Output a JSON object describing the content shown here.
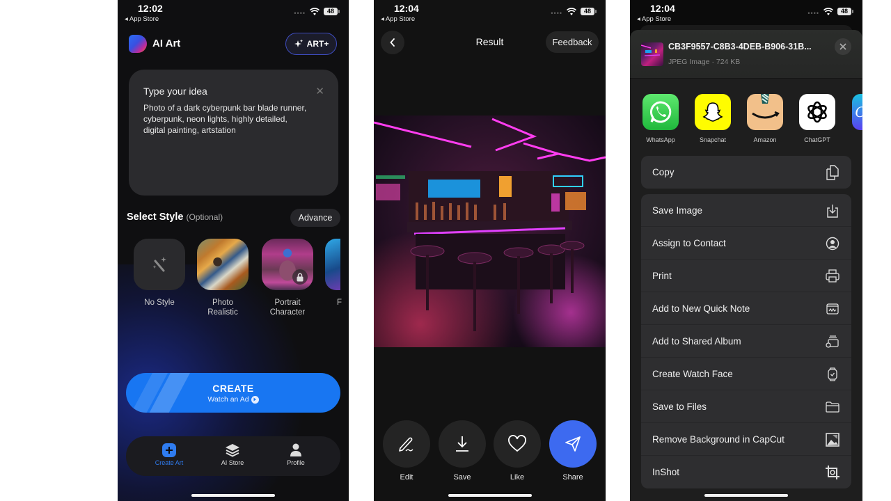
{
  "colors": {
    "accent_blue": "#1876f2",
    "share_blue": "#3d6af0",
    "tab_active": "#2f7cf0",
    "card_bg": "#2b2b2e"
  },
  "screens": [
    {
      "status": {
        "time": "12:02",
        "back_label": "◂ App Store",
        "battery": "48"
      },
      "header": {
        "app_title": "AI Art",
        "logo_icon": "ai-art-logo",
        "premium_button": "ART+",
        "premium_icon": "sparkles-icon"
      },
      "prompt": {
        "title": "Type your idea",
        "value": "Photo of a dark cyberpunk bar blade runner, cyberpunk, neon lights, highly detailed, digital painting, artstation",
        "clear_icon": "close-icon"
      },
      "style_section": {
        "title": "Select Style",
        "optional": "(Optional)",
        "advance_button": "Advance",
        "styles": [
          {
            "label": "No Style",
            "icon": "magic-wand-icon"
          },
          {
            "label": "Photo Realistic"
          },
          {
            "label": "Portrait Character",
            "locked": true
          },
          {
            "label": "F"
          }
        ]
      },
      "create_button": {
        "label": "CREATE",
        "sub_label": "Watch an Ad",
        "icon": "play-icon"
      },
      "tabbar": [
        {
          "label": "Create Art",
          "icon": "plus-square-icon",
          "active": true
        },
        {
          "label": "AI Store",
          "icon": "layers-icon",
          "active": false
        },
        {
          "label": "Profile",
          "icon": "person-icon",
          "active": false
        }
      ]
    },
    {
      "status": {
        "time": "12:04",
        "back_label": "◂ App Store",
        "battery": "48"
      },
      "header": {
        "back_icon": "chevron-left-icon",
        "title": "Result",
        "feedback_button": "Feedback"
      },
      "image": {
        "description": "Neon cyberpunk bar interior with stools"
      },
      "actions": [
        {
          "label": "Edit",
          "icon": "pen-icon"
        },
        {
          "label": "Save",
          "icon": "download-icon"
        },
        {
          "label": "Like",
          "icon": "heart-icon"
        },
        {
          "label": "Share",
          "icon": "send-icon",
          "primary": true
        }
      ]
    },
    {
      "status": {
        "time": "12:04",
        "back_label": "◂ App Store",
        "battery": "48"
      },
      "share_sheet": {
        "file_name": "CB3F9557-C8B3-4DEB-B906-31B...",
        "file_meta": "JPEG Image · 724 KB",
        "close_icon": "close-icon",
        "apps": [
          {
            "label": "WhatsApp",
            "color": "#25d366"
          },
          {
            "label": "Snapchat",
            "color": "#fffc00"
          },
          {
            "label": "Amazon",
            "color": "#f2c08a"
          },
          {
            "label": "ChatGPT",
            "color": "#ffffff"
          },
          {
            "label": "C",
            "color": "#2c9be6"
          }
        ],
        "primary_action": {
          "label": "Copy",
          "icon": "copy-icon"
        },
        "actions": [
          {
            "label": "Save Image",
            "icon": "save-image-icon"
          },
          {
            "label": "Assign to Contact",
            "icon": "contact-icon"
          },
          {
            "label": "Print",
            "icon": "printer-icon"
          },
          {
            "label": "Add to New Quick Note",
            "icon": "quick-note-icon"
          },
          {
            "label": "Add to Shared Album",
            "icon": "shared-album-icon"
          },
          {
            "label": "Create Watch Face",
            "icon": "watch-icon"
          },
          {
            "label": "Save to Files",
            "icon": "folder-icon"
          },
          {
            "label": "Remove Background in CapCut",
            "icon": "image-icon"
          },
          {
            "label": "InShot",
            "icon": "crop-icon"
          }
        ]
      }
    }
  ]
}
